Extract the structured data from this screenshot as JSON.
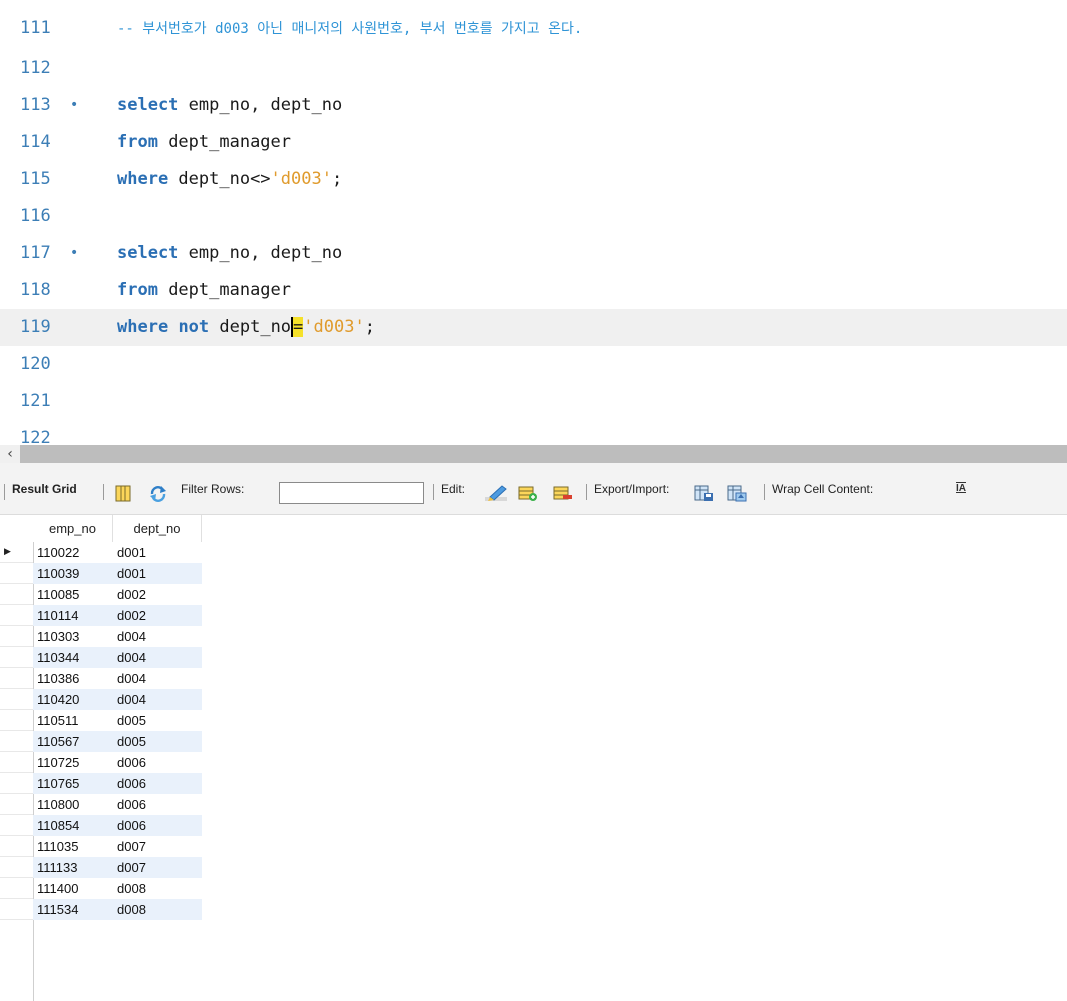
{
  "editor": {
    "lines": [
      {
        "num": "111",
        "comment": "-- 부서번호가 d003 아닌 매니저의 사원번호, 부서 번호를 가지고 온다."
      },
      {
        "num": "112"
      },
      {
        "num": "113",
        "marker": "•",
        "kw1": "select",
        "rest": " emp_no, dept_no"
      },
      {
        "num": "114",
        "kw1": "from",
        "rest": " dept_manager"
      },
      {
        "num": "115",
        "kw1": "where",
        "rest": " dept_no<>",
        "str": "'d003'",
        "tail": ";"
      },
      {
        "num": "116"
      },
      {
        "num": "117",
        "marker": "•",
        "kw1": "select",
        "rest": " emp_no, dept_no"
      },
      {
        "num": "118",
        "kw1": "from",
        "rest": " dept_manager"
      },
      {
        "num": "119",
        "kw1": "where",
        "kw2": "not",
        "rest": " dept_no",
        "cursor": "=",
        "str": "'d003'",
        "tail": ";"
      },
      {
        "num": "120"
      },
      {
        "num": "121"
      },
      {
        "num": "122"
      }
    ]
  },
  "scrollbar": {
    "left_arrow": "‹"
  },
  "toolbar": {
    "result_grid": "Result Grid",
    "filter_rows": "Filter Rows:",
    "filter_value": "",
    "edit": "Edit:",
    "export_import": "Export/Import:",
    "wrap_cell": "Wrap Cell Content:",
    "wrap_icon_text": "IA"
  },
  "grid": {
    "columns": [
      "emp_no",
      "dept_no"
    ],
    "rows": [
      [
        "110022",
        "d001"
      ],
      [
        "110039",
        "d001"
      ],
      [
        "110085",
        "d002"
      ],
      [
        "110114",
        "d002"
      ],
      [
        "110303",
        "d004"
      ],
      [
        "110344",
        "d004"
      ],
      [
        "110386",
        "d004"
      ],
      [
        "110420",
        "d004"
      ],
      [
        "110511",
        "d005"
      ],
      [
        "110567",
        "d005"
      ],
      [
        "110725",
        "d006"
      ],
      [
        "110765",
        "d006"
      ],
      [
        "110800",
        "d006"
      ],
      [
        "110854",
        "d006"
      ],
      [
        "111035",
        "d007"
      ],
      [
        "111133",
        "d007"
      ],
      [
        "111400",
        "d008"
      ],
      [
        "111534",
        "d008"
      ]
    ],
    "current_row_marker": "▶"
  },
  "colors": {
    "keyword": "#2b6fb4",
    "string": "#e09b2d",
    "line_number": "#3c7eb6",
    "alt_row": "#e9f1fb"
  }
}
